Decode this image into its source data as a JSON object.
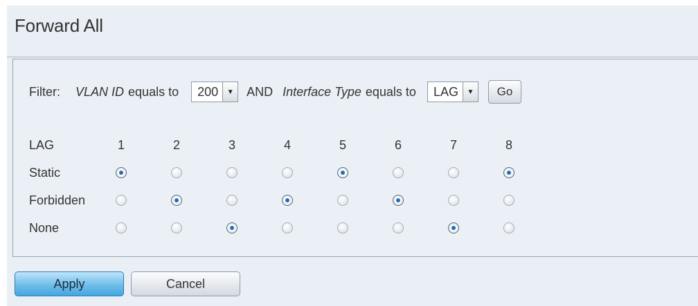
{
  "title": "Forward All",
  "filter": {
    "label": "Filter:",
    "vlan_field": "VLAN ID",
    "equals_to_1": "equals to",
    "vlan_value": "200",
    "and_label": "AND",
    "type_field": "Interface Type",
    "equals_to_2": "equals to",
    "type_value": "LAG",
    "go_label": "Go"
  },
  "table": {
    "header_label": "LAG",
    "columns": [
      "1",
      "2",
      "3",
      "4",
      "5",
      "6",
      "7",
      "8"
    ],
    "rows": [
      {
        "label": "Static",
        "selected": [
          1,
          0,
          0,
          0,
          1,
          0,
          0,
          1
        ]
      },
      {
        "label": "Forbidden",
        "selected": [
          0,
          1,
          0,
          1,
          0,
          1,
          0,
          0
        ]
      },
      {
        "label": "None",
        "selected": [
          0,
          0,
          1,
          0,
          0,
          0,
          1,
          0
        ]
      }
    ]
  },
  "buttons": {
    "apply": "Apply",
    "cancel": "Cancel"
  }
}
